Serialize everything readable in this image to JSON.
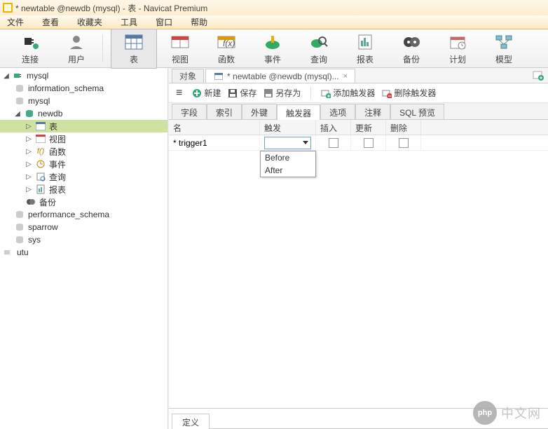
{
  "title": "* newtable @newdb (mysql) - 表 - Navicat Premium",
  "menu": {
    "file": "文件",
    "view": "查看",
    "fav": "收藏夹",
    "tool": "工具",
    "win": "窗口",
    "help": "帮助"
  },
  "toolbar": {
    "connect": "连接",
    "user": "用户",
    "table": "表",
    "view": "视图",
    "func": "函数",
    "event": "事件",
    "query": "查询",
    "report": "报表",
    "backup": "备份",
    "plan": "计划",
    "model": "模型"
  },
  "tree": {
    "root": "mysql",
    "info_schema": "information_schema",
    "mysql_db": "mysql",
    "newdb": "newdb",
    "items": {
      "table": "表",
      "view": "视图",
      "func": "函数",
      "event": "事件",
      "query": "查询",
      "report": "报表",
      "backup": "备份"
    },
    "perf": "performance_schema",
    "sparrow": "sparrow",
    "sys": "sys",
    "utu": "utu"
  },
  "doctabs": {
    "objects": "对象",
    "editing": "* newtable @newdb (mysql)..."
  },
  "actions": {
    "new": "新建",
    "save": "保存",
    "saveas": "另存为",
    "add": "添加触发器",
    "del": "删除触发器"
  },
  "subtabs": {
    "fields": "字段",
    "index": "索引",
    "fk": "外键",
    "trigger": "触发器",
    "options": "选项",
    "comment": "注释",
    "sql": "SQL 预览"
  },
  "grid": {
    "cols": {
      "name": "名",
      "trig": "触发",
      "ins": "插入",
      "upd": "更新",
      "del": "删除"
    },
    "row": {
      "name": "* trigger1"
    },
    "dropdown": {
      "before": "Before",
      "after": "After"
    }
  },
  "defn": "定义",
  "watermark": {
    "badge": "php",
    "text": "中文网"
  }
}
